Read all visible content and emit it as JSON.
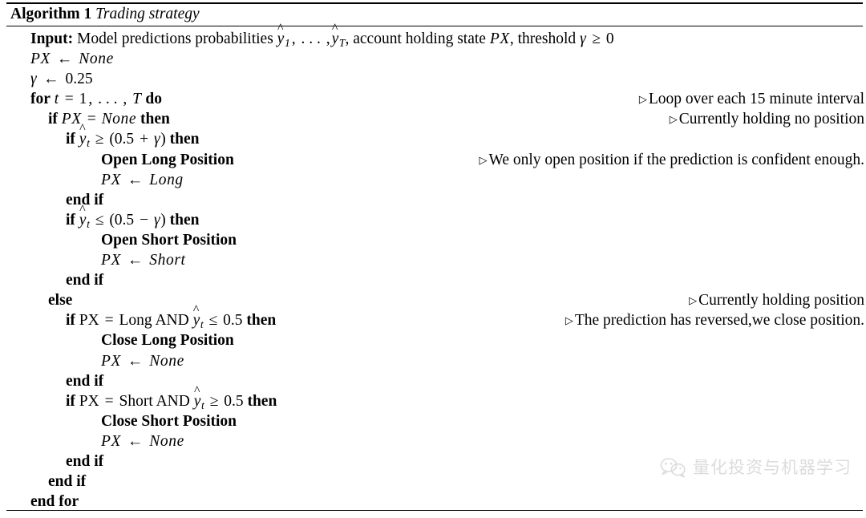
{
  "algorithm": {
    "label": "Algorithm 1",
    "caption": "Trading strategy",
    "lines": [
      {
        "indent": 0,
        "code_html": "<b class=\"kw\">Input:</b> Model predictions probabilities <span class=\"hat-wrap\"><span class=\"hat\">^</span><span class=\"mvar\">y</span></span><span class=\"sub\">1</span><span class=\"op\">,</span> . . . <span class=\"op\">,</span><span class=\"hat-wrap\"><span class=\"hat\">^</span><span class=\"mvar\">y</span></span><span class=\"sub\">T</span>, account holding state <span class=\"mvar\">PX</span>, threshold <span class=\"mvar\">&#947;</span> <span class=\"op\">&#8805;</span> <span class=\"num\">0</span>",
        "text": "Input: Model predictions probabilities y1, ..., yT, account holding state PX, threshold gamma >= 0",
        "comment": ""
      },
      {
        "indent": 0,
        "code_html": "<span class=\"mvar\">PX</span> <span class=\"arrow\">&#8592;</span> <span class=\"mvar\">None</span>",
        "text": "PX <- None",
        "comment": ""
      },
      {
        "indent": 0,
        "code_html": "<span class=\"mvar\">&#947;</span> <span class=\"arrow\">&#8592;</span> <span class=\"num\">0.25</span>",
        "text": "gamma <- 0.25",
        "comment": ""
      },
      {
        "indent": 0,
        "code_html": "<b class=\"kw\">for</b> <span class=\"mvar\">t</span> <span class=\"op\">=</span> <span class=\"num\">1</span><span class=\"op\">,</span> . . . <span class=\"op\">,</span> <span class=\"mvar\">T</span> <b class=\"kw\">do</b>",
        "text": "for t = 1, ..., T do",
        "comment": "Loop over each 15 minute interval"
      },
      {
        "indent": 1,
        "code_html": "<b class=\"kw\">if</b> <span class=\"mvar\">PX</span> <span class=\"op\">=</span> <span class=\"mvar\">None</span> <b class=\"kw\">then</b>",
        "text": "if PX = None then",
        "comment": "Currently holding no position"
      },
      {
        "indent": 2,
        "code_html": "<b class=\"kw\">if</b> <span class=\"hat-wrap\"><span class=\"hat\">^</span><span class=\"mvar\">y</span></span><span class=\"sub\">t</span> <span class=\"op\">&#8805;</span> <span class=\"num\">(0.5</span> <span class=\"op\">+</span> <span class=\"mvar\">&#947;</span><span class=\"num\">)</span> <b class=\"kw\">then</b>",
        "text": "if y_t >= (0.5 + gamma) then",
        "comment": ""
      },
      {
        "indent": 4,
        "code_html": "<b class=\"kw\">Open Long Position</b>",
        "text": "Open Long Position",
        "comment": "We only open position if the prediction is confident enough."
      },
      {
        "indent": 4,
        "code_html": "<span class=\"mvar\">PX</span> <span class=\"arrow\">&#8592;</span> <span class=\"mvar\">Long</span>",
        "text": "PX <- Long",
        "comment": ""
      },
      {
        "indent": 2,
        "code_html": "<b class=\"kw\">end if</b>",
        "text": "end if",
        "comment": ""
      },
      {
        "indent": 2,
        "code_html": "<b class=\"kw\">if</b> <span class=\"hat-wrap\"><span class=\"hat\">^</span><span class=\"mvar\">y</span></span><span class=\"sub\">t</span> <span class=\"op\">&#8804;</span> <span class=\"num\">(0.5</span> <span class=\"op\">&#8722;</span> <span class=\"mvar\">&#947;</span><span class=\"num\">)</span> <b class=\"kw\">then</b>",
        "text": "if y_t <= (0.5 - gamma) then",
        "comment": ""
      },
      {
        "indent": 4,
        "code_html": "<b class=\"kw\">Open Short Position</b>",
        "text": "Open Short Position",
        "comment": ""
      },
      {
        "indent": 4,
        "code_html": "<span class=\"mvar\">PX</span> <span class=\"arrow\">&#8592;</span> <span class=\"mvar\">Short</span>",
        "text": "PX <- Short",
        "comment": ""
      },
      {
        "indent": 2,
        "code_html": "<b class=\"kw\">end if</b>",
        "text": "end if",
        "comment": ""
      },
      {
        "indent": 1,
        "code_html": "<b class=\"kw\">else</b>",
        "text": "else",
        "comment": "Currently holding position"
      },
      {
        "indent": 2,
        "code_html": "<b class=\"kw\">if</b> <span class=\"mrm\">PX</span> <span class=\"op\">=</span> <span class=\"mrm\">Long</span> <span class=\"mrm\">AND</span> <span class=\"hat-wrap\"><span class=\"hat\">^</span><span class=\"mvar\">y</span></span><span class=\"sub\">t</span> <span class=\"op\">&#8804;</span> <span class=\"num\">0.5</span> <b class=\"kw\">then</b>",
        "text": "if PX = Long AND y_t <= 0.5 then",
        "comment": "The prediction has reversed,we close position."
      },
      {
        "indent": 4,
        "code_html": "<b class=\"kw\">Close Long Position</b>",
        "text": "Close Long Position",
        "comment": ""
      },
      {
        "indent": 4,
        "code_html": "<span class=\"mvar\">PX</span> <span class=\"arrow\">&#8592;</span> <span class=\"mvar\">None</span>",
        "text": "PX <- None",
        "comment": ""
      },
      {
        "indent": 2,
        "code_html": "<b class=\"kw\">end if</b>",
        "text": "end if",
        "comment": ""
      },
      {
        "indent": 2,
        "code_html": "<b class=\"kw\">if</b> <span class=\"mrm\">PX</span> <span class=\"op\">=</span> <span class=\"mrm\">Short</span> <span class=\"mrm\">AND</span> <span class=\"hat-wrap\"><span class=\"hat\">^</span><span class=\"mvar\">y</span></span><span class=\"sub\">t</span> <span class=\"op\">&#8805;</span> <span class=\"num\">0.5</span> <b class=\"kw\">then</b>",
        "text": "if PX = Short AND y_t >= 0.5 then",
        "comment": ""
      },
      {
        "indent": 4,
        "code_html": "<b class=\"kw\">Close Short Position</b>",
        "text": "Close Short Position",
        "comment": ""
      },
      {
        "indent": 4,
        "code_html": "<span class=\"mvar\">PX</span> <span class=\"arrow\">&#8592;</span> <span class=\"mvar\">None</span>",
        "text": "PX <- None",
        "comment": ""
      },
      {
        "indent": 2,
        "code_html": "<b class=\"kw\">end if</b>",
        "text": "end if",
        "comment": ""
      },
      {
        "indent": 1,
        "code_html": "<b class=\"kw\">end if</b>",
        "text": "end if",
        "comment": ""
      },
      {
        "indent": 0,
        "code_html": "<b class=\"kw\">end for</b>",
        "text": "end for",
        "comment": ""
      }
    ]
  },
  "watermark": {
    "text": "量化投资与机器学习",
    "icon": "wechat-icon",
    "color": "#dcdcdc"
  }
}
